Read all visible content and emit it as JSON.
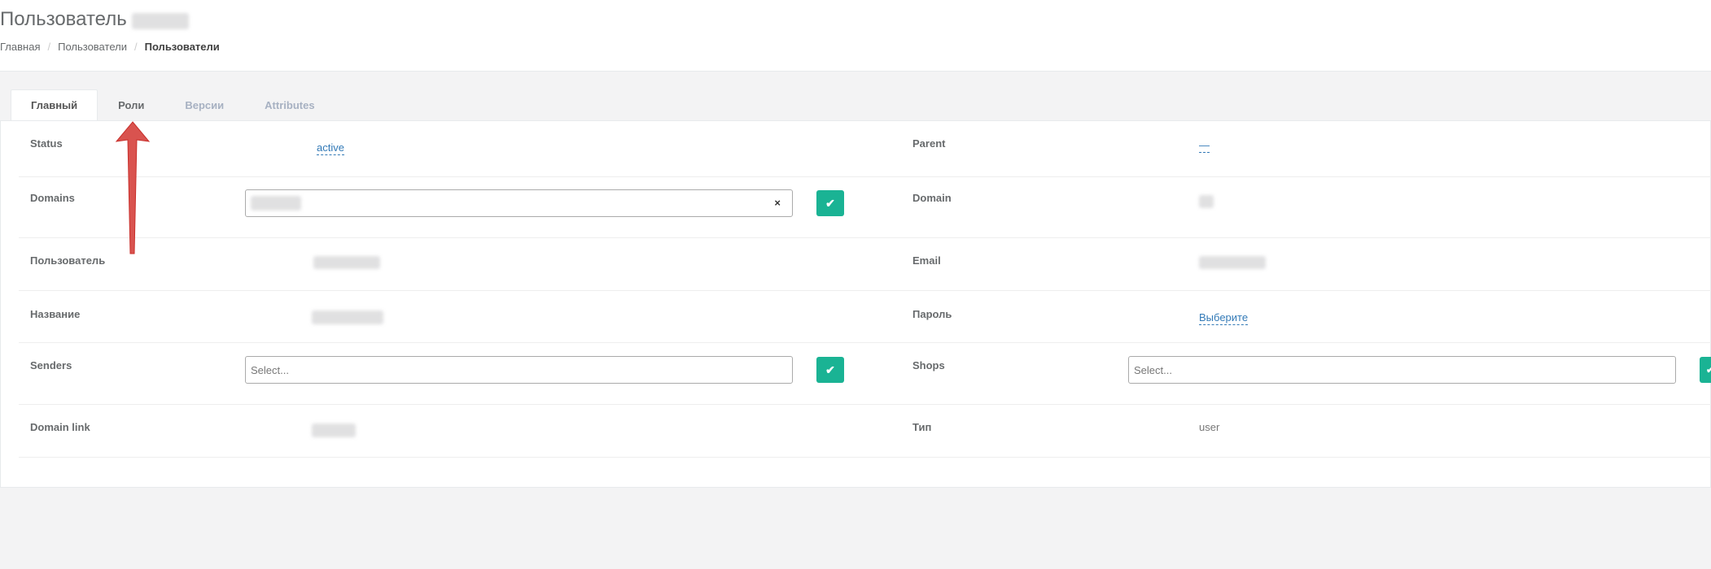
{
  "header": {
    "title": "Пользователь",
    "breadcrumb": [
      "Главная",
      "Пользователи",
      "Пользователи"
    ]
  },
  "tabs": [
    "Главный",
    "Роли",
    "Версии",
    "Attributes"
  ],
  "form": {
    "status_label": "Status",
    "status_value": "active",
    "parent_label": "Parent",
    "parent_value": "—",
    "domains_label": "Domains",
    "domains_clear": "×",
    "domain_label": "Domain",
    "user_label": "Пользователь",
    "email_label": "Email",
    "name_label": "Название",
    "password_label": "Пароль",
    "password_value": "Выберите",
    "senders_label": "Senders",
    "senders_placeholder": "Select...",
    "shops_label": "Shops",
    "shops_placeholder": "Select...",
    "domain_link_label": "Domain link",
    "type_label": "Тип",
    "type_value": "user",
    "confirm_icon": "✔"
  },
  "colors": {
    "accent": "#1ab394",
    "link": "#337ab7",
    "annotation_arrow": "#d9534f"
  }
}
